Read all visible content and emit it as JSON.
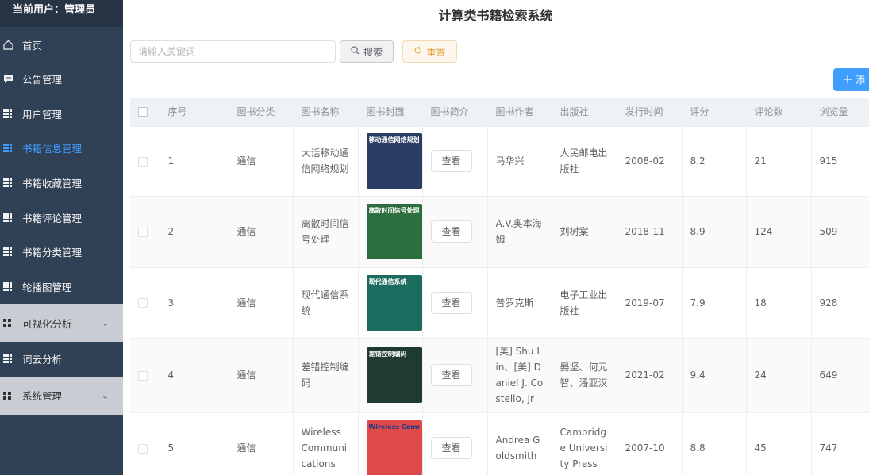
{
  "sidebar": {
    "user_label": "当前用户：管理员",
    "items": [
      {
        "label": "首页",
        "icon": "home-icon"
      },
      {
        "label": "公告管理",
        "icon": "chat-icon"
      },
      {
        "label": "用户管理",
        "icon": "grid-icon"
      },
      {
        "label": "书籍信息管理",
        "icon": "grid-icon",
        "active": true
      },
      {
        "label": "书籍收藏管理",
        "icon": "grid-icon"
      },
      {
        "label": "书籍评论管理",
        "icon": "grid-icon"
      },
      {
        "label": "书籍分类管理",
        "icon": "grid-icon"
      },
      {
        "label": "轮播图管理",
        "icon": "grid-icon"
      },
      {
        "label": "可视化分析",
        "icon": "menu-grid-icon",
        "submenu": true
      },
      {
        "label": "词云分析",
        "icon": "grid-icon"
      },
      {
        "label": "系统管理",
        "icon": "menu-grid-icon",
        "submenu": true
      }
    ],
    "active_color": "#409eff",
    "bg_color": "#304156"
  },
  "header": {
    "title": "计算类书籍检索系统"
  },
  "toolbar": {
    "search_placeholder": "请输入关键词",
    "search_label": "搜索",
    "reset_label": "重置",
    "add_label": "添"
  },
  "table": {
    "columns": [
      "序号",
      "图书分类",
      "图书名称",
      "图书封面",
      "图书简介",
      "图书作者",
      "出版社",
      "发行时间",
      "评分",
      "评论数",
      "浏览量"
    ],
    "view_label": "查看",
    "rows": [
      {
        "index": "1",
        "category": "通信",
        "name": "大话移动通信网络规划",
        "cover_text": "移动通信网络规划",
        "cover_color": "#2b3d63",
        "author": "马华兴",
        "publisher": "人民邮电出版社",
        "date": "2008-02",
        "score": "8.2",
        "comments": "21",
        "views": "915"
      },
      {
        "index": "2",
        "category": "通信",
        "name": "离散时间信号处理",
        "cover_text": "离散时间信号处理",
        "cover_color": "#2d6e3e",
        "author": "A.V.奥本海姆",
        "publisher": "刘树棠",
        "date": "2018-11",
        "score": "8.9",
        "comments": "124",
        "views": "509"
      },
      {
        "index": "3",
        "category": "通信",
        "name": "现代通信系统",
        "cover_text": "现代通信系统",
        "cover_color": "#1b6b5e",
        "author": "普罗克斯",
        "publisher": "电子工业出版社",
        "date": "2019-07",
        "score": "7.9",
        "comments": "18",
        "views": "928"
      },
      {
        "index": "4",
        "category": "通信",
        "name": "差错控制编码",
        "cover_text": "差错控制编码",
        "cover_color": "#1f3a2e",
        "author": "[美] Shu Lin、[美] Daniel J. Costello, Jr",
        "publisher": "晏坚、何元智、潘亚汉",
        "date": "2021-02",
        "score": "9.4",
        "comments": "24",
        "views": "649"
      },
      {
        "index": "5",
        "category": "通信",
        "name": "Wireless Communications",
        "cover_text": "Wireless Communications",
        "cover_color": "#e0494a",
        "author": "Andrea Goldsmith",
        "publisher": "Cambridge University Press",
        "date": "2007-10",
        "score": "8.8",
        "comments": "45",
        "views": "747"
      }
    ]
  }
}
